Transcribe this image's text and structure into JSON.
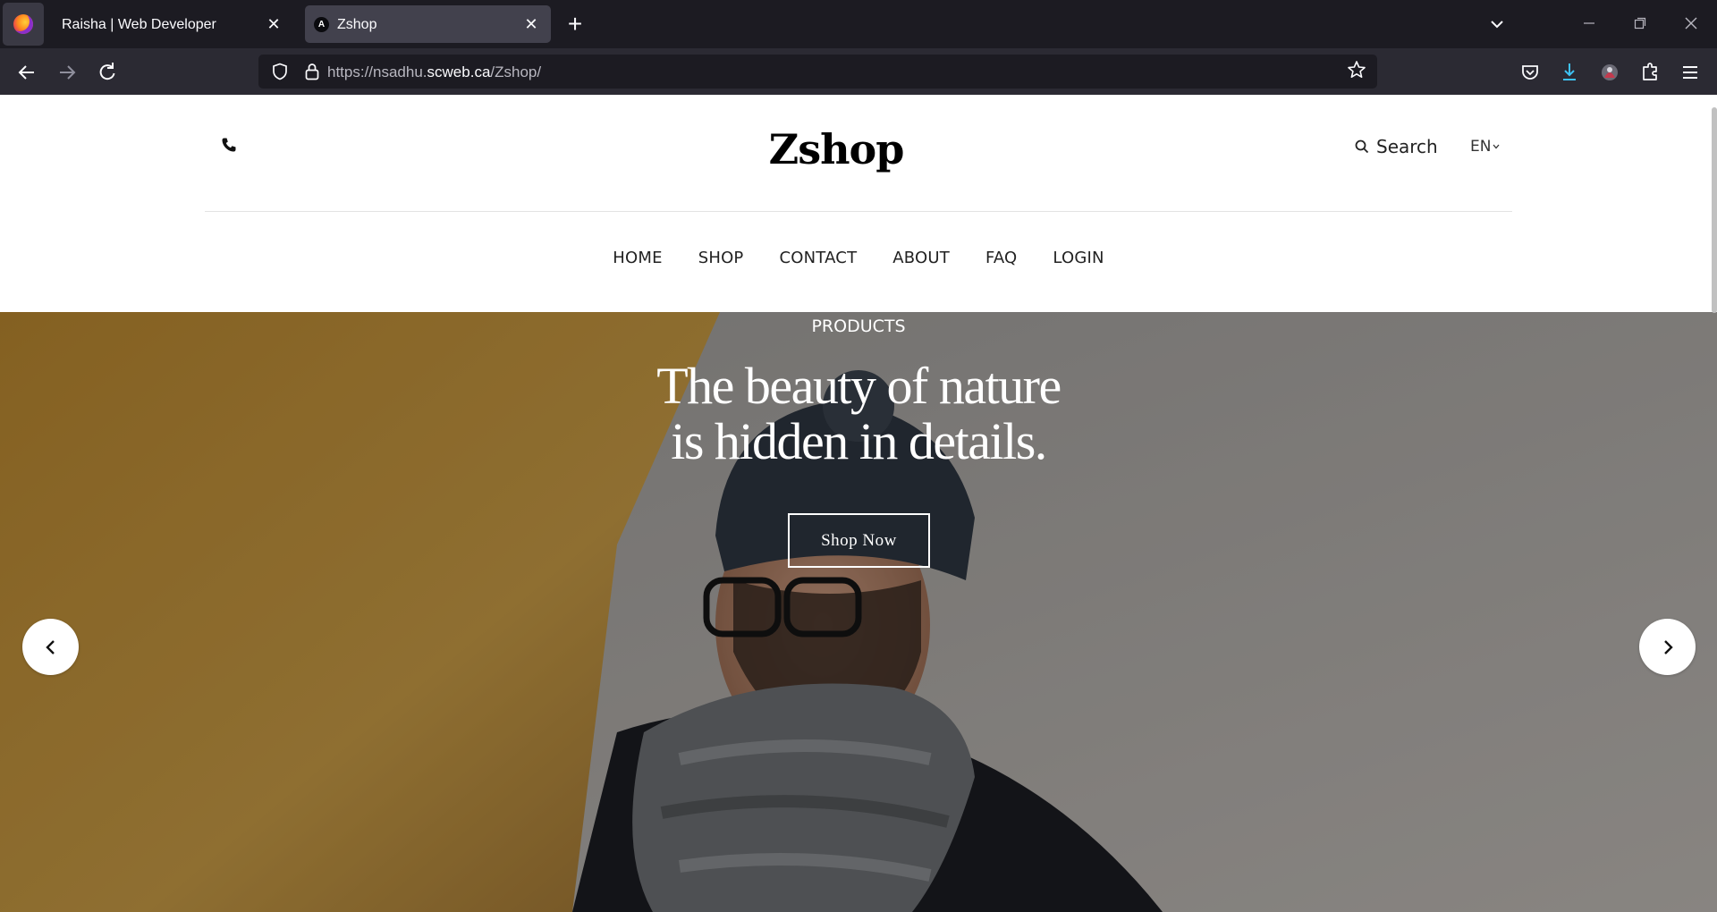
{
  "browser": {
    "tabs": [
      {
        "title": "Raisha | Web Developer",
        "active": false
      },
      {
        "title": "Zshop",
        "active": true,
        "favicon_letter": "A"
      }
    ],
    "new_tab_symbol": "+",
    "close_symbol": "✕",
    "url": {
      "prefix": "https://nsadhu.",
      "host": "scweb.ca",
      "path": "/Zshop/"
    }
  },
  "header": {
    "logo": "Zshop",
    "search_label": "Search",
    "language": "EN"
  },
  "menu": [
    "HOME",
    "SHOP",
    "CONTACT",
    "ABOUT",
    "FAQ",
    "LOGIN"
  ],
  "hero": {
    "kicker": "PRODUCTS",
    "title_line1": "The beauty of nature",
    "title_line2": "is hidden in details.",
    "button_label": "Shop Now"
  },
  "icons": {
    "phone": "phone-icon",
    "search": "search-icon",
    "prev": "chevron-left-icon",
    "next": "chevron-right-icon"
  }
}
